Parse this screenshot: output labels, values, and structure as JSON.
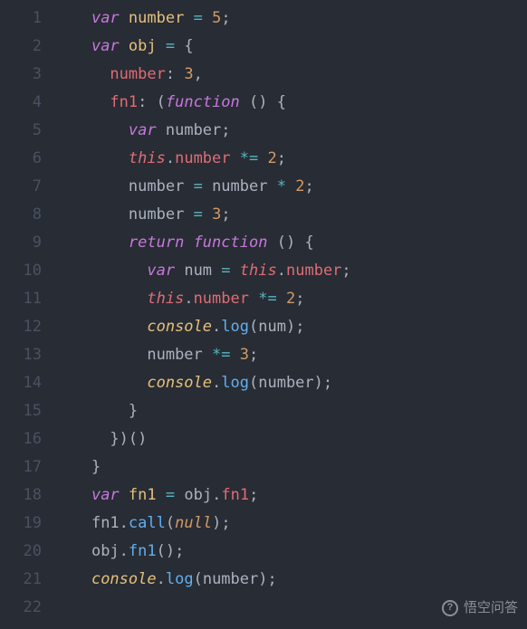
{
  "lines": [
    {
      "n": 1,
      "indent": 2
    },
    {
      "n": 2,
      "indent": 2
    },
    {
      "n": 3,
      "indent": 3
    },
    {
      "n": 4,
      "indent": 3
    },
    {
      "n": 5,
      "indent": 4
    },
    {
      "n": 6,
      "indent": 4
    },
    {
      "n": 7,
      "indent": 4
    },
    {
      "n": 8,
      "indent": 4
    },
    {
      "n": 9,
      "indent": 4
    },
    {
      "n": 10,
      "indent": 5
    },
    {
      "n": 11,
      "indent": 5
    },
    {
      "n": 12,
      "indent": 5
    },
    {
      "n": 13,
      "indent": 5
    },
    {
      "n": 14,
      "indent": 5
    },
    {
      "n": 15,
      "indent": 4
    },
    {
      "n": 16,
      "indent": 3
    },
    {
      "n": 17,
      "indent": 2
    },
    {
      "n": 18,
      "indent": 2
    },
    {
      "n": 19,
      "indent": 2
    },
    {
      "n": 20,
      "indent": 2
    },
    {
      "n": 21,
      "indent": 2
    },
    {
      "n": 22,
      "indent": 2
    }
  ],
  "tokens": {
    "var": "var",
    "return": "return",
    "function": "function",
    "this": "this",
    "console": "console",
    "log": "log",
    "call": "call",
    "null": "null",
    "number": "number",
    "obj": "obj",
    "fn1": "fn1",
    "num": "num",
    "v5": "5",
    "v3": "3",
    "v2": "2"
  },
  "watermark": "悟空问答"
}
